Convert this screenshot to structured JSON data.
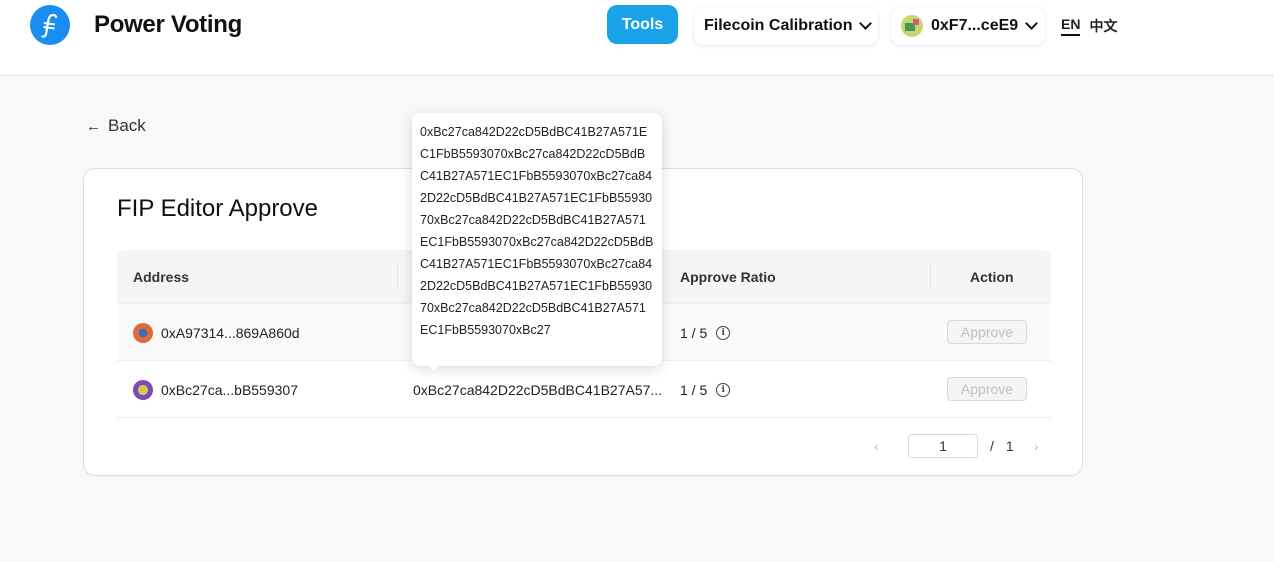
{
  "header": {
    "brand": "Power Voting",
    "tools_label": "Tools",
    "network_label": "Filecoin Calibration",
    "wallet_label": "0xF7...ceE9",
    "lang_en": "EN",
    "lang_zh": "中文"
  },
  "back_label": "Back",
  "card": {
    "title": "FIP Editor Approve",
    "columns": [
      "Address",
      "",
      "Approve Ratio",
      "Action"
    ],
    "rows": [
      {
        "address": "0xA97314...869A860d",
        "cid": "",
        "ratio": "1 / 5",
        "action": "Approve",
        "avatar_color": "#e06b3a"
      },
      {
        "address": "0xBc27ca...bB559307",
        "cid": "0xBc27ca842D22cD5BdBC41B27A57...",
        "ratio": "1 / 5",
        "action": "Approve",
        "avatar_color": "#7a4bb8"
      }
    ]
  },
  "pagination": {
    "prev": "‹",
    "current": "1",
    "separator": "/",
    "total": "1",
    "next": "›"
  },
  "tooltip": {
    "text": "0xBc27ca842D22cD5BdBC41B27A571EC1FbB5593070xBc27ca842D22cD5BdBC41B27A571EC1FbB5593070xBc27ca842D22cD5BdBC41B27A571EC1FbB5593070xBc27ca842D22cD5BdBC41B27A571EC1FbB5593070xBc27ca842D22cD5BdBC41B27A571EC1FbB5593070xBc27ca842D22cD5BdBC41B27A571EC1FbB5593070xBc27ca842D22cD5BdBC41B27A571EC1FbB5593070xBc27"
  },
  "colors": {
    "accent": "#1aa3e8",
    "logo": "#1a8ef0"
  }
}
